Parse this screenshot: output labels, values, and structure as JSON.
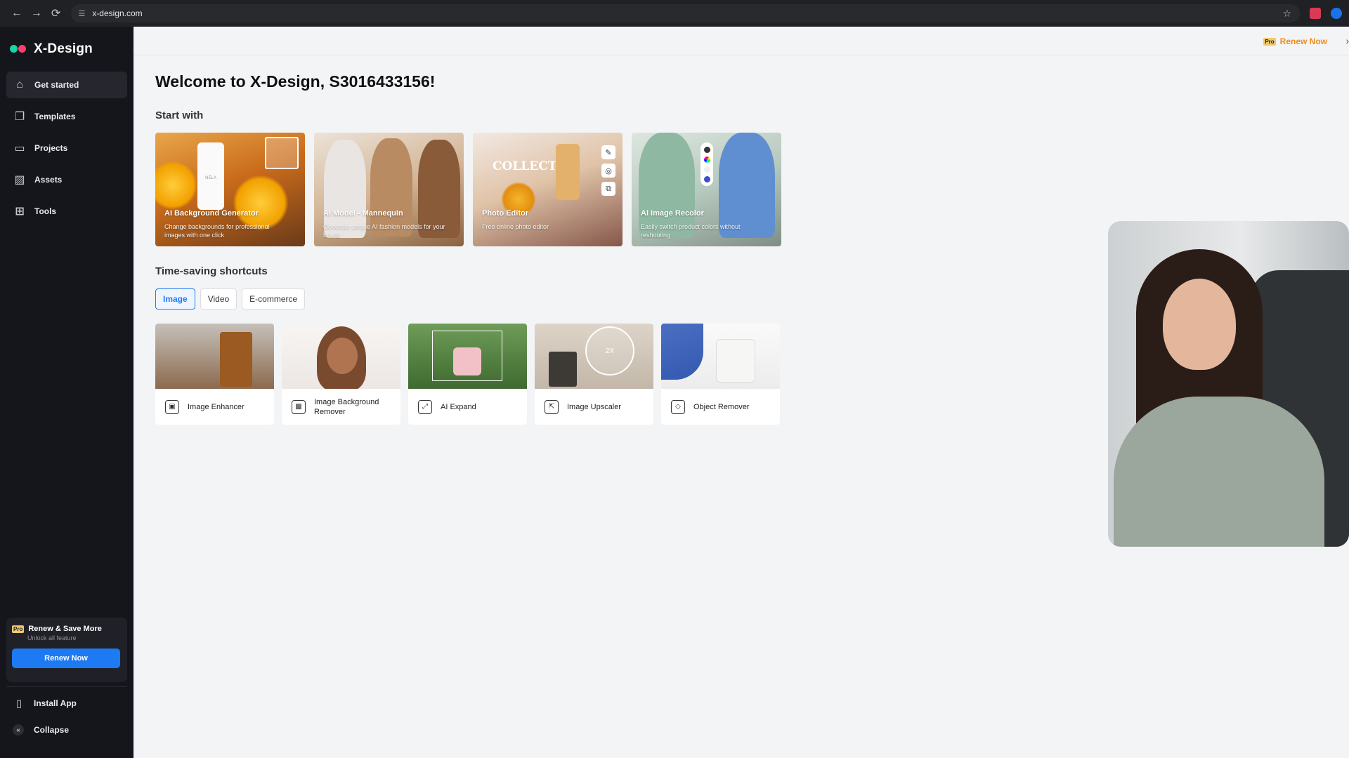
{
  "browser": {
    "url": "x-design.com",
    "nav": {
      "back": "←",
      "forward": "→",
      "reload": "⟳"
    }
  },
  "sidebar": {
    "brand": "X-Design",
    "items": [
      {
        "label": "Get started",
        "icon": "home-icon",
        "active": true
      },
      {
        "label": "Templates",
        "icon": "templates-icon",
        "active": false
      },
      {
        "label": "Projects",
        "icon": "folder-icon",
        "active": false
      },
      {
        "label": "Assets",
        "icon": "assets-icon",
        "active": false
      },
      {
        "label": "Tools",
        "icon": "grid-icon",
        "active": false
      }
    ],
    "promo": {
      "badge": "Pro",
      "title": "Renew & Save More",
      "subtitle": "Unlock all feature",
      "button": "Renew Now"
    },
    "bottom": {
      "install": "Install App",
      "collapse": "Collapse"
    }
  },
  "topbar": {
    "badge": "Pro",
    "renew": "Renew Now"
  },
  "main": {
    "welcome": "Welcome to X-Design, S3016433156!",
    "start_with_title": "Start with",
    "start_cards": [
      {
        "title": "AI Background Generator",
        "desc": "Change backgrounds for professional images with one click"
      },
      {
        "title": "AI Model - Mannequin",
        "desc": "Generate unique AI fashion models for your brand"
      },
      {
        "title": "Photo Editor",
        "desc": "Free online photo editor"
      },
      {
        "title": "AI Image Recolor",
        "desc": "Easily switch product colors without reshooting"
      }
    ],
    "shortcuts_title": "Time-saving shortcuts",
    "tabs": [
      {
        "label": "Image",
        "active": true
      },
      {
        "label": "Video",
        "active": false
      },
      {
        "label": "E-commerce",
        "active": false
      }
    ],
    "shortcuts": [
      {
        "label": "Image Enhancer",
        "icon": "enhance-icon"
      },
      {
        "label": "Image Background Remover",
        "icon": "bg-remove-icon"
      },
      {
        "label": "AI Expand",
        "icon": "expand-icon"
      },
      {
        "label": "Image Upscaler",
        "icon": "upscale-icon"
      },
      {
        "label": "Object Remover",
        "icon": "eraser-icon"
      }
    ],
    "card_art": {
      "bottle_brand": "NÉLA",
      "photo_editor_overlay": "COLLECTIO",
      "upscale_label": "2X"
    }
  },
  "colors": {
    "accent": "#1d7af3",
    "renew_orange": "#f08c1a",
    "sidebar_bg": "#15161b"
  }
}
